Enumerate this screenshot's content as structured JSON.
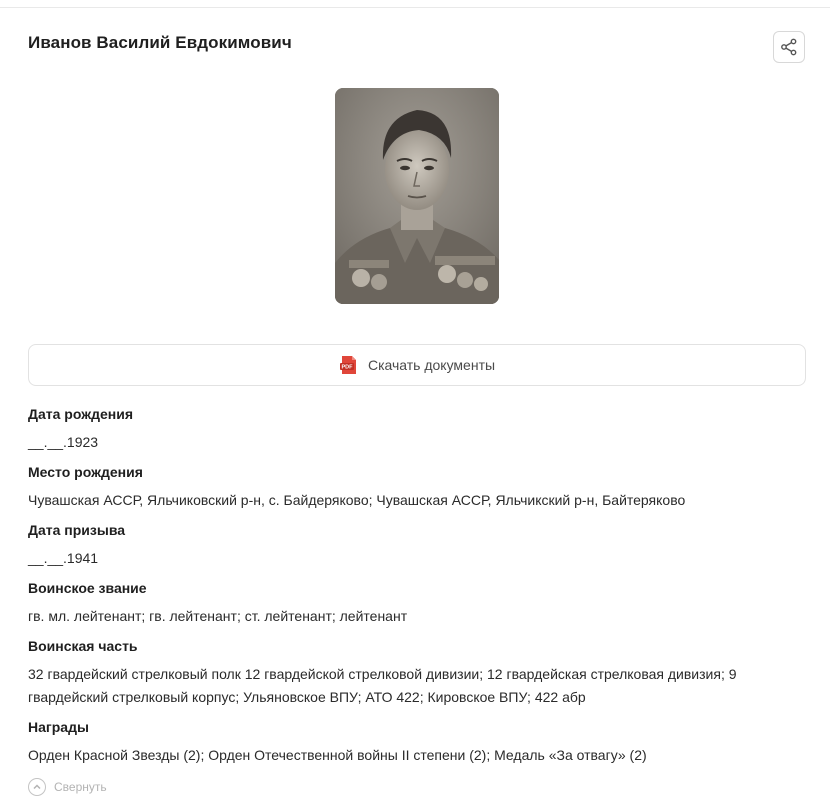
{
  "person": {
    "name": "Иванов Василий Евдокимович"
  },
  "icons": {
    "share": "share-icon",
    "pdf": "pdf-icon",
    "collapse": "chevron-up-icon"
  },
  "colors": {
    "pdf_red": "#e0463a",
    "border": "#e2e2e2",
    "muted": "#b3b3b3"
  },
  "download": {
    "label": "Скачать документы",
    "badge": "PDF"
  },
  "fields": [
    {
      "label": "Дата рождения",
      "value": "__.__.1923"
    },
    {
      "label": "Место рождения",
      "value": "Чувашская АССР, Яльчиковский р-н, с. Байдеряково; Чувашская АССР, Яльчикский р-н, Байтеряково"
    },
    {
      "label": "Дата призыва",
      "value": "__.__.1941"
    },
    {
      "label": "Воинское звание",
      "value": "гв. мл. лейтенант; гв. лейтенант; ст. лейтенант; лейтенант"
    },
    {
      "label": "Воинская часть",
      "value": "32 гвардейский стрелковый полк 12 гвардейской стрелковой дивизии; 12 гвардейская стрелковая дивизия; 9 гвардейский стрелковый корпус; Ульяновское ВПУ; АТО 422; Кировское ВПУ; 422 абр"
    },
    {
      "label": "Награды",
      "value": "Орден Красной Звезды (2); Орден Отечественной войны II степени (2); Медаль «За отвагу» (2)"
    }
  ],
  "collapse": {
    "label": "Свернуть"
  }
}
